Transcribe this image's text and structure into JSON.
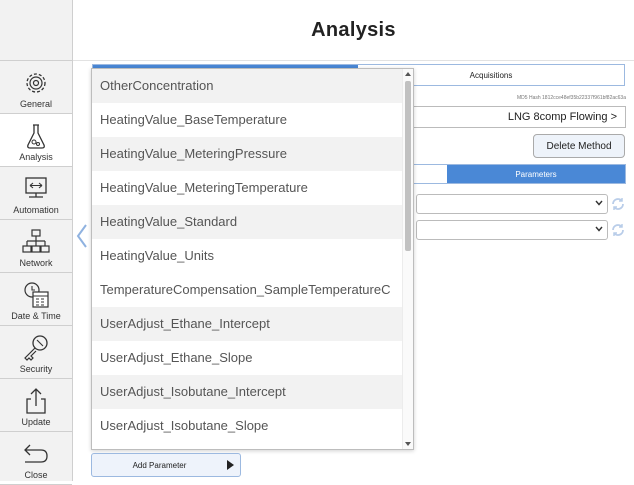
{
  "header": {
    "title": "Analysis"
  },
  "sidebar": {
    "items": [
      {
        "label": "General",
        "icon": "gear-icon"
      },
      {
        "label": "Analysis",
        "icon": "flask-icon"
      },
      {
        "label": "Automation",
        "icon": "automation-icon"
      },
      {
        "label": "Network",
        "icon": "network-icon"
      },
      {
        "label": "Date & Time",
        "icon": "calendar-clock-icon"
      },
      {
        "label": "Security",
        "icon": "key-icon"
      },
      {
        "label": "Update",
        "icon": "upload-icon"
      },
      {
        "label": "Close",
        "icon": "close-arrow-icon"
      }
    ],
    "active": "Analysis"
  },
  "panel": {
    "tab_acquisitions": "Acquisitions",
    "md5": "MD5 Hash 1812cce48ef35b22337f961bf82ac63a",
    "method": "LNG 8comp Flowing >",
    "delete_method": "Delete Method",
    "tab_parameters": "Parameters"
  },
  "dropdown": {
    "items": [
      "OtherConcentration",
      "HeatingValue_BaseTemperature",
      "HeatingValue_MeteringPressure",
      "HeatingValue_MeteringTemperature",
      "HeatingValue_Standard",
      "HeatingValue_Units",
      "TemperatureCompensation_SampleTemperatureC",
      "UserAdjust_Ethane_Intercept",
      "UserAdjust_Ethane_Slope",
      "UserAdjust_Isobutane_Intercept",
      "UserAdjust_Isobutane_Slope"
    ]
  },
  "add_parameter": {
    "label": "Add Parameter"
  },
  "colors": {
    "accent": "#4a88d6",
    "sidebar_bg": "#f2f2f2",
    "scroll_thumb": "#c1c1c1"
  }
}
